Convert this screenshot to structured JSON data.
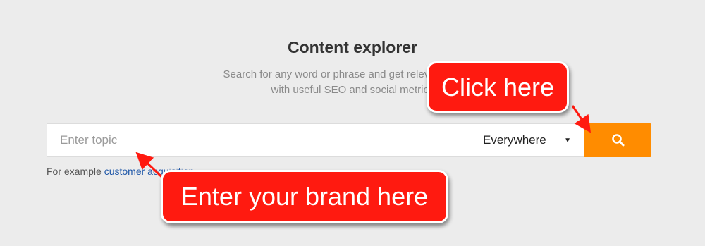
{
  "header": {
    "title": "Content explorer",
    "subtitle_line1": "Search for any word or phrase and get relevant content",
    "subtitle_line2": "with useful SEO and social metrics"
  },
  "search": {
    "placeholder": "Enter topic",
    "value": "",
    "scope_selected": "Everywhere",
    "button_icon": "search-icon"
  },
  "example": {
    "prefix": "For example",
    "link_text": "customer acquisition"
  },
  "annotations": {
    "click_here": "Click here",
    "enter_brand": "Enter your brand here"
  },
  "colors": {
    "accent": "#ff8c00",
    "callout": "#ff1a10",
    "link": "#1f57a8"
  }
}
